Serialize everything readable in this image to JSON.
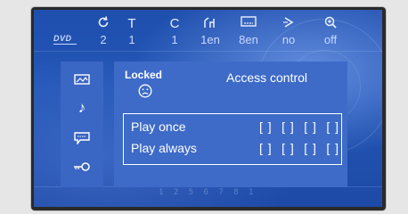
{
  "menu": {
    "dvd_logo": "DVD",
    "items": [
      {
        "icon": "rotate-icon",
        "glyph": "↻",
        "value": "2"
      },
      {
        "icon": "title-icon",
        "glyph": "T",
        "value": "1"
      },
      {
        "icon": "chapter-icon",
        "glyph": "C",
        "value": "1en"
      },
      {
        "icon": "audio-icon",
        "glyph": "ᵢᑦ",
        "value": "8en"
      },
      {
        "icon": "subtitle-icon",
        "glyph": "▭",
        "value": "no"
      },
      {
        "icon": "angle-icon",
        "glyph": "⊳",
        "value": "off"
      }
    ],
    "zoom_glyph": "⊕"
  },
  "sidebar": {
    "items": [
      {
        "icon": "picture-icon"
      },
      {
        "icon": "music-note-icon",
        "glyph": "♪"
      },
      {
        "icon": "speech-bubble-icon"
      },
      {
        "icon": "key-icon"
      }
    ]
  },
  "panel": {
    "locked_label": "Locked",
    "face_icon": "sad-face-icon",
    "title": "Access control",
    "options": [
      {
        "label": "Play once",
        "slots": [
          "[ ]",
          "[ ]",
          "[ ]",
          "[ ]"
        ]
      },
      {
        "label": "Play always",
        "slots": [
          "[ ]",
          "[ ]",
          "[ ]",
          "[ ]"
        ]
      }
    ]
  },
  "background_digits": "1 2 5 6 7 8 1"
}
